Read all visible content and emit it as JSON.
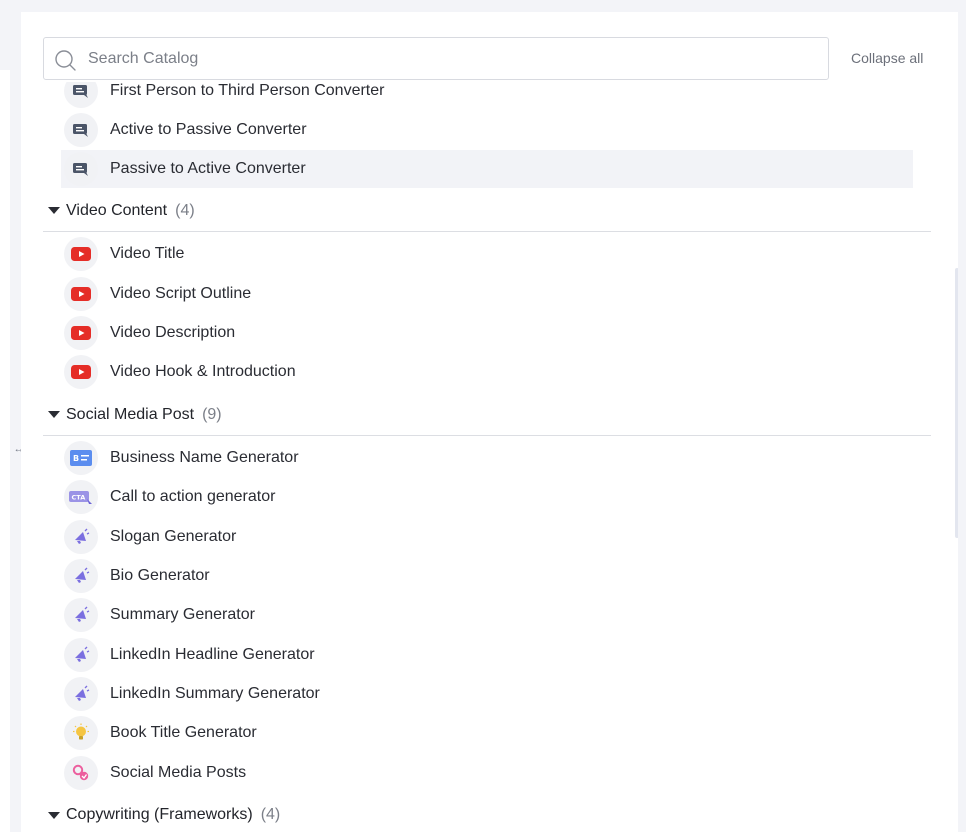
{
  "search": {
    "placeholder": "Search Catalog"
  },
  "collapse_all_label": "Collapse all",
  "resize_handle_glyph": "↔",
  "top_items": [
    {
      "label": "First Person to Third Person Converter",
      "icon": "chat-convert-icon"
    },
    {
      "label": "Active to Passive Converter",
      "icon": "chat-convert-icon"
    },
    {
      "label": "Passive to Active Converter",
      "icon": "chat-convert-icon",
      "highlighted": true
    }
  ],
  "groups": [
    {
      "title": "Video Content",
      "count": "(4)",
      "items": [
        {
          "label": "Video Title",
          "icon": "youtube-icon"
        },
        {
          "label": "Video Script Outline",
          "icon": "youtube-icon"
        },
        {
          "label": "Video Description",
          "icon": "youtube-icon"
        },
        {
          "label": "Video Hook & Introduction",
          "icon": "youtube-icon"
        }
      ]
    },
    {
      "title": "Social Media Post",
      "count": "(9)",
      "items": [
        {
          "label": "Business Name Generator",
          "icon": "business-card-icon"
        },
        {
          "label": "Call to action generator",
          "icon": "cta-icon",
          "icon_text": "CTA"
        },
        {
          "label": "Slogan Generator",
          "icon": "megaphone-icon"
        },
        {
          "label": "Bio Generator",
          "icon": "megaphone-icon"
        },
        {
          "label": "Summary Generator",
          "icon": "megaphone-icon"
        },
        {
          "label": "LinkedIn Headline Generator",
          "icon": "megaphone-icon"
        },
        {
          "label": "LinkedIn Summary Generator",
          "icon": "megaphone-icon"
        },
        {
          "label": "Book Title Generator",
          "icon": "lightbulb-icon"
        },
        {
          "label": "Social Media Posts",
          "icon": "social-share-icon"
        }
      ]
    },
    {
      "title": "Copywriting (Frameworks)",
      "count": "(4)"
    }
  ],
  "colors": {
    "youtube_red": "#e52d27",
    "slate_icon": "#4b5568",
    "purple_icon": "#7b6fe0",
    "business_blue": "#5b8def",
    "bulb_yellow": "#f5c542",
    "social_pink": "#ec5f9e"
  }
}
